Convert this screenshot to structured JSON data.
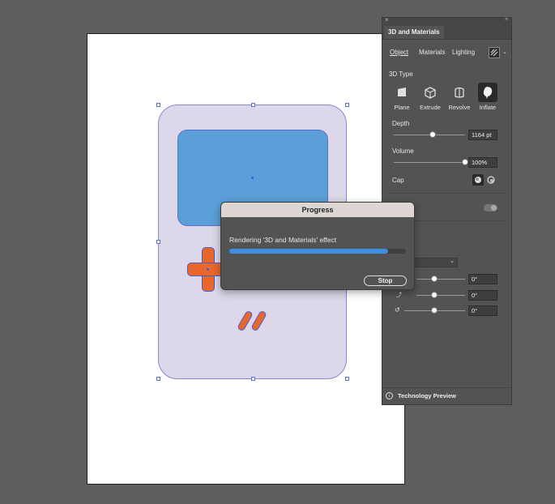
{
  "panel": {
    "title": "3D and Materials",
    "subtabs": [
      "Object",
      "Materials",
      "Lighting"
    ],
    "section_3d_type": "3D Type",
    "types": [
      "Plane",
      "Extrude",
      "Revolve",
      "Inflate"
    ],
    "selected_type": "Inflate",
    "depth_label": "Depth",
    "depth_value": "1164 pt",
    "depth_slider_fraction": 0.55,
    "volume_label": "Volume",
    "volume_value": "100%",
    "volume_slider_fraction": 1.0,
    "cap_label": "Cap",
    "rotation_values": [
      "0°",
      "0°",
      "0°"
    ],
    "footer_label": "Technology Preview"
  },
  "dialog": {
    "title": "Progress",
    "message": "Rendering '3D and Materials' effect",
    "progress_fraction": 0.9,
    "stop_label": "Stop"
  },
  "colors": {
    "canvas_bg": "#5e5e5e",
    "device": "#dcd7e9",
    "screen": "#5a9fd8",
    "buttons": "#e8682c",
    "progress": "#3f8fe0",
    "selection": "#5b6ee0"
  }
}
